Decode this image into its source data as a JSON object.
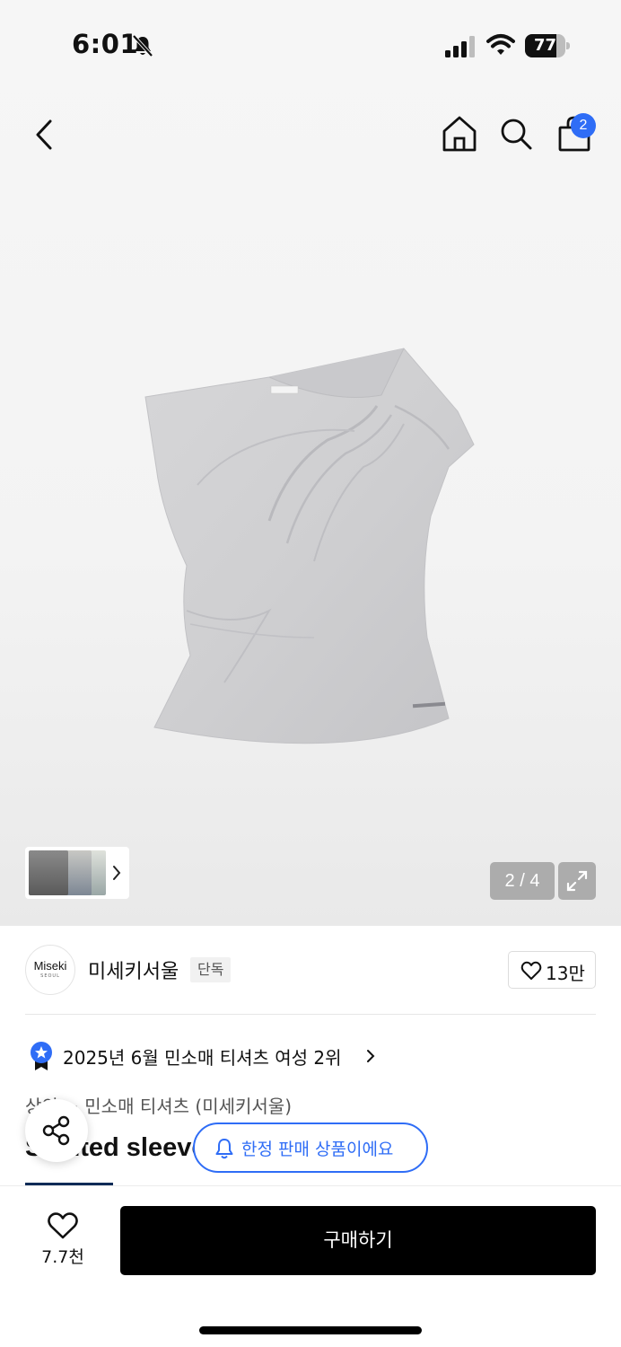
{
  "status_bar": {
    "time": "6:01",
    "battery_level": "77",
    "battery_fraction": 0.77,
    "bell_icon": "bell-slash-icon"
  },
  "nav": {
    "cart_count": "2",
    "icons": [
      "chevron-left-icon",
      "home-icon",
      "search-icon",
      "shopping-bag-icon"
    ]
  },
  "gallery": {
    "current_page": 2,
    "total_pages": 4,
    "counter": "2 / 4",
    "expand_icon": "expand-icon",
    "thumbnail_count": 3
  },
  "brand": {
    "logo_name": "Miseki",
    "logo_sub": "SEOUL",
    "name": "미세키서울",
    "badge": "단독",
    "like_count": "13만"
  },
  "ranking": {
    "text": "2025년 6월 민소매 티셔츠 여성 2위",
    "medal_color": "#2f6df6"
  },
  "breadcrumb": "상의 > 민소매 티셔츠 (미세키서울)",
  "product": {
    "title": "Slanted sleeveless top"
  },
  "floating": {
    "limited_label": "한정 판매 상품이에요",
    "accent_color": "#2f6df6"
  },
  "bottom_bar": {
    "wish_count": "7.7천",
    "buy_label": "구매하기"
  }
}
